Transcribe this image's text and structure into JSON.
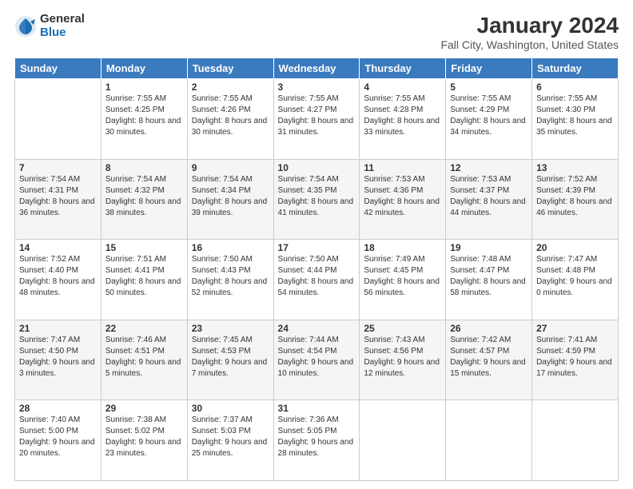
{
  "logo": {
    "general": "General",
    "blue": "Blue"
  },
  "title": "January 2024",
  "subtitle": "Fall City, Washington, United States",
  "days_of_week": [
    "Sunday",
    "Monday",
    "Tuesday",
    "Wednesday",
    "Thursday",
    "Friday",
    "Saturday"
  ],
  "weeks": [
    [
      {
        "num": "",
        "sunrise": "",
        "sunset": "",
        "daylight": "",
        "empty": true
      },
      {
        "num": "1",
        "sunrise": "Sunrise: 7:55 AM",
        "sunset": "Sunset: 4:25 PM",
        "daylight": "Daylight: 8 hours and 30 minutes."
      },
      {
        "num": "2",
        "sunrise": "Sunrise: 7:55 AM",
        "sunset": "Sunset: 4:26 PM",
        "daylight": "Daylight: 8 hours and 30 minutes."
      },
      {
        "num": "3",
        "sunrise": "Sunrise: 7:55 AM",
        "sunset": "Sunset: 4:27 PM",
        "daylight": "Daylight: 8 hours and 31 minutes."
      },
      {
        "num": "4",
        "sunrise": "Sunrise: 7:55 AM",
        "sunset": "Sunset: 4:28 PM",
        "daylight": "Daylight: 8 hours and 33 minutes."
      },
      {
        "num": "5",
        "sunrise": "Sunrise: 7:55 AM",
        "sunset": "Sunset: 4:29 PM",
        "daylight": "Daylight: 8 hours and 34 minutes."
      },
      {
        "num": "6",
        "sunrise": "Sunrise: 7:55 AM",
        "sunset": "Sunset: 4:30 PM",
        "daylight": "Daylight: 8 hours and 35 minutes."
      }
    ],
    [
      {
        "num": "7",
        "sunrise": "Sunrise: 7:54 AM",
        "sunset": "Sunset: 4:31 PM",
        "daylight": "Daylight: 8 hours and 36 minutes."
      },
      {
        "num": "8",
        "sunrise": "Sunrise: 7:54 AM",
        "sunset": "Sunset: 4:32 PM",
        "daylight": "Daylight: 8 hours and 38 minutes."
      },
      {
        "num": "9",
        "sunrise": "Sunrise: 7:54 AM",
        "sunset": "Sunset: 4:34 PM",
        "daylight": "Daylight: 8 hours and 39 minutes."
      },
      {
        "num": "10",
        "sunrise": "Sunrise: 7:54 AM",
        "sunset": "Sunset: 4:35 PM",
        "daylight": "Daylight: 8 hours and 41 minutes."
      },
      {
        "num": "11",
        "sunrise": "Sunrise: 7:53 AM",
        "sunset": "Sunset: 4:36 PM",
        "daylight": "Daylight: 8 hours and 42 minutes."
      },
      {
        "num": "12",
        "sunrise": "Sunrise: 7:53 AM",
        "sunset": "Sunset: 4:37 PM",
        "daylight": "Daylight: 8 hours and 44 minutes."
      },
      {
        "num": "13",
        "sunrise": "Sunrise: 7:52 AM",
        "sunset": "Sunset: 4:39 PM",
        "daylight": "Daylight: 8 hours and 46 minutes."
      }
    ],
    [
      {
        "num": "14",
        "sunrise": "Sunrise: 7:52 AM",
        "sunset": "Sunset: 4:40 PM",
        "daylight": "Daylight: 8 hours and 48 minutes."
      },
      {
        "num": "15",
        "sunrise": "Sunrise: 7:51 AM",
        "sunset": "Sunset: 4:41 PM",
        "daylight": "Daylight: 8 hours and 50 minutes."
      },
      {
        "num": "16",
        "sunrise": "Sunrise: 7:50 AM",
        "sunset": "Sunset: 4:43 PM",
        "daylight": "Daylight: 8 hours and 52 minutes."
      },
      {
        "num": "17",
        "sunrise": "Sunrise: 7:50 AM",
        "sunset": "Sunset: 4:44 PM",
        "daylight": "Daylight: 8 hours and 54 minutes."
      },
      {
        "num": "18",
        "sunrise": "Sunrise: 7:49 AM",
        "sunset": "Sunset: 4:45 PM",
        "daylight": "Daylight: 8 hours and 56 minutes."
      },
      {
        "num": "19",
        "sunrise": "Sunrise: 7:48 AM",
        "sunset": "Sunset: 4:47 PM",
        "daylight": "Daylight: 8 hours and 58 minutes."
      },
      {
        "num": "20",
        "sunrise": "Sunrise: 7:47 AM",
        "sunset": "Sunset: 4:48 PM",
        "daylight": "Daylight: 9 hours and 0 minutes."
      }
    ],
    [
      {
        "num": "21",
        "sunrise": "Sunrise: 7:47 AM",
        "sunset": "Sunset: 4:50 PM",
        "daylight": "Daylight: 9 hours and 3 minutes."
      },
      {
        "num": "22",
        "sunrise": "Sunrise: 7:46 AM",
        "sunset": "Sunset: 4:51 PM",
        "daylight": "Daylight: 9 hours and 5 minutes."
      },
      {
        "num": "23",
        "sunrise": "Sunrise: 7:45 AM",
        "sunset": "Sunset: 4:53 PM",
        "daylight": "Daylight: 9 hours and 7 minutes."
      },
      {
        "num": "24",
        "sunrise": "Sunrise: 7:44 AM",
        "sunset": "Sunset: 4:54 PM",
        "daylight": "Daylight: 9 hours and 10 minutes."
      },
      {
        "num": "25",
        "sunrise": "Sunrise: 7:43 AM",
        "sunset": "Sunset: 4:56 PM",
        "daylight": "Daylight: 9 hours and 12 minutes."
      },
      {
        "num": "26",
        "sunrise": "Sunrise: 7:42 AM",
        "sunset": "Sunset: 4:57 PM",
        "daylight": "Daylight: 9 hours and 15 minutes."
      },
      {
        "num": "27",
        "sunrise": "Sunrise: 7:41 AM",
        "sunset": "Sunset: 4:59 PM",
        "daylight": "Daylight: 9 hours and 17 minutes."
      }
    ],
    [
      {
        "num": "28",
        "sunrise": "Sunrise: 7:40 AM",
        "sunset": "Sunset: 5:00 PM",
        "daylight": "Daylight: 9 hours and 20 minutes."
      },
      {
        "num": "29",
        "sunrise": "Sunrise: 7:38 AM",
        "sunset": "Sunset: 5:02 PM",
        "daylight": "Daylight: 9 hours and 23 minutes."
      },
      {
        "num": "30",
        "sunrise": "Sunrise: 7:37 AM",
        "sunset": "Sunset: 5:03 PM",
        "daylight": "Daylight: 9 hours and 25 minutes."
      },
      {
        "num": "31",
        "sunrise": "Sunrise: 7:36 AM",
        "sunset": "Sunset: 5:05 PM",
        "daylight": "Daylight: 9 hours and 28 minutes."
      },
      {
        "num": "",
        "sunrise": "",
        "sunset": "",
        "daylight": "",
        "empty": true
      },
      {
        "num": "",
        "sunrise": "",
        "sunset": "",
        "daylight": "",
        "empty": true
      },
      {
        "num": "",
        "sunrise": "",
        "sunset": "",
        "daylight": "",
        "empty": true
      }
    ]
  ]
}
